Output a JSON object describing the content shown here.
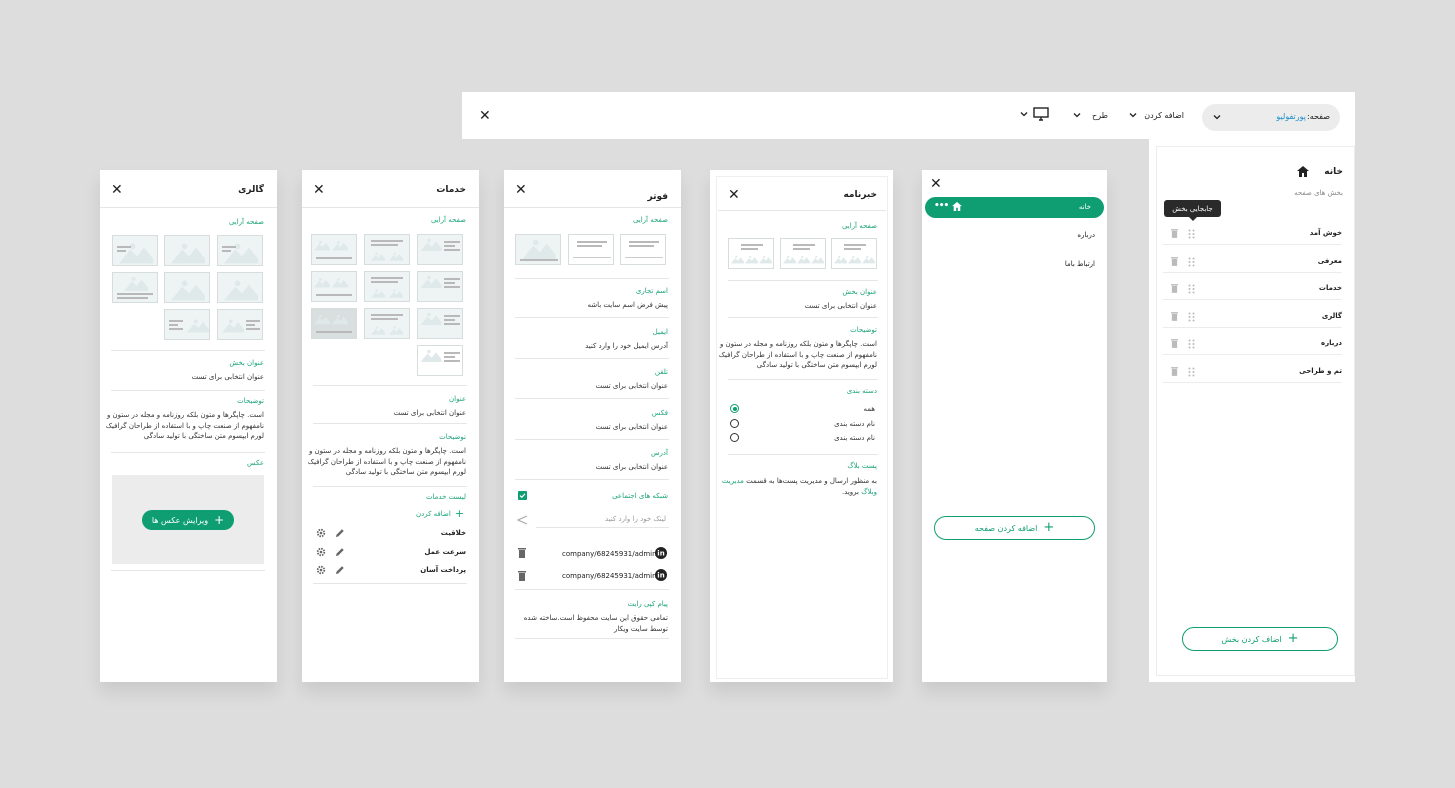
{
  "topbar": {
    "page_label": "صفحه:",
    "page_value": "پورتفولیو",
    "add_label": "اضافه کردن",
    "design_label": "طرح"
  },
  "page_panel": {
    "home_title": "خانه",
    "sections_caption": "بخش های صفحه",
    "tooltip": "جابجایی بخش",
    "sections": [
      "خوش آمد",
      "معرفی",
      "خدمات",
      "گالری",
      "درباره",
      "تم و طراحی"
    ],
    "add_section_button": "اضاف کردن بخش"
  },
  "nav_panel": {
    "items": [
      "خانه",
      "درباره",
      "ارتباط باما"
    ],
    "add_page_button": "اضافه کردن صفحه"
  },
  "newsletter_panel": {
    "title": "خبرنامه",
    "layout_label": "صفحه آرایی",
    "section_title_label": "عنوان بخش",
    "section_title_value": "عنوان انتخابی برای تست",
    "description_label": "توضیحات",
    "description_lines": [
      "است. چاپگرها و متون بلکه روزنامه و مجله در ستون و",
      "نامفهوم از صنعت چاپ و با استفاده از طراحان گرافیک",
      "لورم ایپسوم متن ساختگی با تولید سادگی"
    ],
    "category_label": "دسته بندی",
    "categories": [
      "همه",
      "نام دسته بندی",
      "نام دسته بندی"
    ],
    "blog_post_label": "پست بلاگ",
    "blog_line1_prefix": "به منظور ارسال و مدیریت پست‌ها به قسمت",
    "blog_link_1": "مدیریت",
    "blog_link_2": "وبلاگ",
    "blog_line2_suffix": "بروید."
  },
  "footer_panel": {
    "title": "فوتر",
    "layout_label": "صفحه آرایی",
    "fields": [
      {
        "label": "اسم تجاری",
        "value": "پیش فرض اسم سایت باشه"
      },
      {
        "label": "ایمیل",
        "value": "آدرس ایمیل خود را وارد کنید"
      },
      {
        "label": "تلفن",
        "value": "عنوان انتخابی برای تست"
      },
      {
        "label": "فکس",
        "value": "عنوان انتخابی برای تست"
      },
      {
        "label": "آدرس",
        "value": "عنوان انتخابی برای تست"
      }
    ],
    "social_label": "شبکه های اجتماعی",
    "social_placeholder": "لینک خود را وارد کنید",
    "social_links": [
      "company/68245931/admin/",
      "company/68245931/admin/"
    ],
    "copyright_label": "پیام کپی رایت",
    "copyright_lines": [
      "تمامی حقوق این سایت محفوظ است.ساخته شده",
      "توسط سایت ویکار"
    ]
  },
  "services_panel": {
    "title": "خدمات",
    "layout_label": "صفحه آرایی",
    "heading_label": "عنوان",
    "heading_value": "عنوان انتخابی برای تست",
    "description_label": "توضیحات",
    "description_lines": [
      "است. چاپگرها و متون بلکه روزنامه و مجله در ستون و",
      "نامفهوم از صنعت چاپ و با استفاده از طراحان گرافیک",
      "لورم ایپسوم متن ساختگی با تولید سادگی"
    ],
    "services_list_label": "لیست خدمات",
    "add_service": "اضافه کردن",
    "services": [
      "خلاقیت",
      "سرعت عمل",
      "پرداخت آسان"
    ]
  },
  "gallery_panel": {
    "title": "گالری",
    "layout_label": "صفحه آرایی",
    "section_title_label": "عنوان بخش",
    "section_title_value": "عنوان انتخابی برای تست",
    "description_label": "توضیحات",
    "description_lines": [
      "است. چاپگرها و متون بلکه روزنامه و مجله در ستون و",
      "نامفهوم از صنعت چاپ و با استفاده از طراحان گرافیک",
      "لورم ایپسوم متن ساختگی با تولید سادگی"
    ],
    "image_label": "عکس",
    "edit_images_button": "ویرایش عکس ها"
  },
  "colors": {
    "accent": "#0f9e72",
    "background": "#dddddd",
    "panel": "#ffffff",
    "thumb_fill": "#e7efef"
  }
}
